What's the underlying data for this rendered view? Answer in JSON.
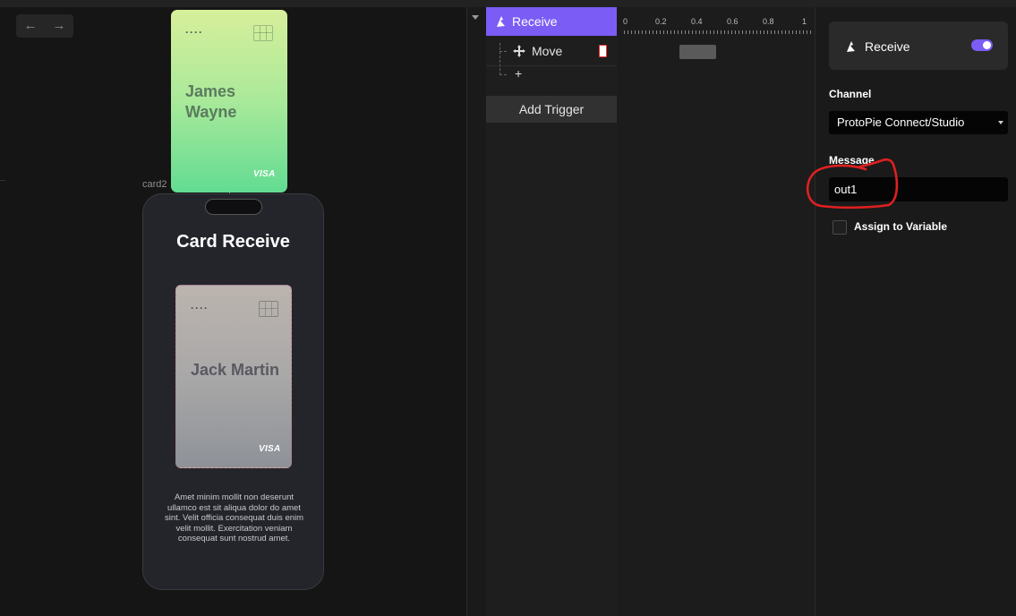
{
  "canvas": {
    "nav": {
      "back": "←",
      "forward": "→"
    },
    "green_card": {
      "dots": "····",
      "name": "James Wayne",
      "brand": "VISA"
    },
    "phone": {
      "layer_label": "card2",
      "title": "Card Receive",
      "card": {
        "dots": "····",
        "name": "Jack Martin",
        "brand": "VISA"
      },
      "body_text": "Amet minim mollit non deserunt ullamco est sit aliqua dolor do amet sint. Velit officia consequat duis enim velit mollit. Exercitation veniam consequat sunt nostrud amet."
    }
  },
  "timeline": {
    "trigger_label": "Receive",
    "response_label": "Move",
    "add_response": "+",
    "add_trigger": "Add Trigger",
    "ruler": [
      "0",
      "0.2",
      "0.4",
      "0.6",
      "0.8",
      "1"
    ]
  },
  "properties": {
    "trigger_title": "Receive",
    "trigger_enabled": true,
    "channel_label": "Channel",
    "channel_value": "ProtoPie Connect/Studio",
    "message_label": "Message",
    "message_value": "out1",
    "assign_label": "Assign to Variable",
    "accent_color": "#7b5cf5",
    "annotation_color": "#e02020"
  }
}
